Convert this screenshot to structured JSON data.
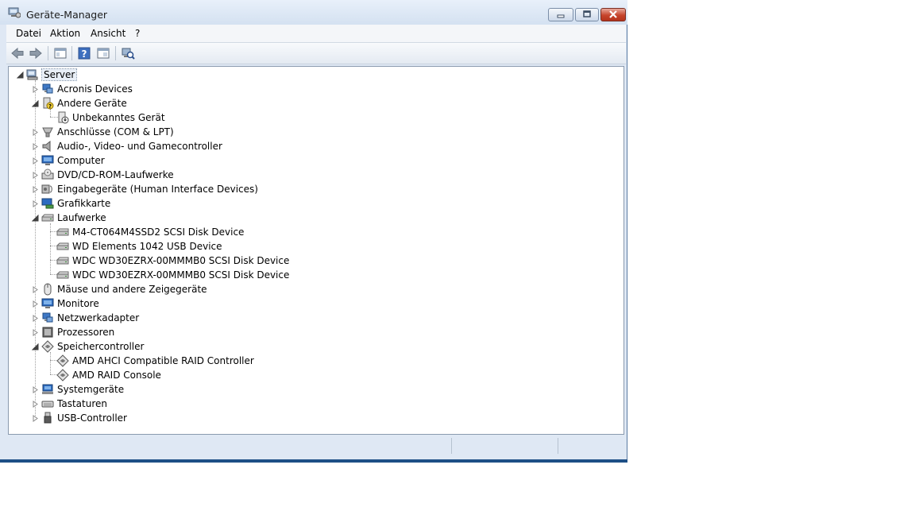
{
  "window": {
    "title": "Geräte-Manager",
    "accent_color": "#dfe8f4",
    "close_color": "#c6442c"
  },
  "menu": [
    {
      "label": "Datei"
    },
    {
      "label": "Aktion"
    },
    {
      "label": "Ansicht"
    },
    {
      "label": "?"
    }
  ],
  "toolbar": [
    {
      "name": "back-arrow-icon"
    },
    {
      "name": "forward-arrow-icon"
    },
    {
      "name": "show-hide-console-tree-icon"
    },
    {
      "name": "help-icon"
    },
    {
      "name": "properties-icon"
    },
    {
      "name": "scan-hardware-icon"
    }
  ],
  "tree": {
    "root": {
      "label": "Server",
      "icon": "computer-icon"
    },
    "groups": [
      {
        "label": "Acronis Devices",
        "icon": "network-icon",
        "expanded": false,
        "children": []
      },
      {
        "label": "Andere Geräte",
        "icon": "unknown-device-icon",
        "expanded": true,
        "children": [
          {
            "label": "Unbekanntes Gerät",
            "icon": "warning-device-icon"
          }
        ]
      },
      {
        "label": "Anschlüsse (COM & LPT)",
        "icon": "port-icon",
        "expanded": false,
        "children": []
      },
      {
        "label": "Audio-, Video- und Gamecontroller",
        "icon": "speaker-icon",
        "expanded": false,
        "children": []
      },
      {
        "label": "Computer",
        "icon": "monitor-icon",
        "expanded": false,
        "children": []
      },
      {
        "label": "DVD/CD-ROM-Laufwerke",
        "icon": "disc-drive-icon",
        "expanded": false,
        "children": []
      },
      {
        "label": "Eingabegeräte (Human Interface Devices)",
        "icon": "hid-icon",
        "expanded": false,
        "children": []
      },
      {
        "label": "Grafikkarte",
        "icon": "display-adapter-icon",
        "expanded": false,
        "children": []
      },
      {
        "label": "Laufwerke",
        "icon": "disk-drive-icon",
        "expanded": true,
        "children": [
          {
            "label": "M4-CT064M4SSD2 SCSI Disk Device",
            "icon": "disk-drive-icon"
          },
          {
            "label": "WD Elements 1042 USB Device",
            "icon": "disk-drive-icon"
          },
          {
            "label": "WDC WD30EZRX-00MMMB0 SCSI Disk Device",
            "icon": "disk-drive-icon"
          },
          {
            "label": "WDC WD30EZRX-00MMMB0 SCSI Disk Device",
            "icon": "disk-drive-icon"
          }
        ]
      },
      {
        "label": "Mäuse und andere Zeigegeräte",
        "icon": "mouse-icon",
        "expanded": false,
        "children": []
      },
      {
        "label": "Monitore",
        "icon": "monitor-icon",
        "expanded": false,
        "children": []
      },
      {
        "label": "Netzwerkadapter",
        "icon": "network-icon",
        "expanded": false,
        "children": []
      },
      {
        "label": "Prozessoren",
        "icon": "processor-icon",
        "expanded": false,
        "children": []
      },
      {
        "label": "Speichercontroller",
        "icon": "storage-controller-icon",
        "expanded": true,
        "children": [
          {
            "label": "AMD AHCI Compatible RAID Controller",
            "icon": "storage-controller-icon"
          },
          {
            "label": "AMD RAID Console",
            "icon": "storage-controller-icon"
          }
        ]
      },
      {
        "label": "Systemgeräte",
        "icon": "system-device-icon",
        "expanded": false,
        "children": []
      },
      {
        "label": "Tastaturen",
        "icon": "keyboard-icon",
        "expanded": false,
        "children": []
      },
      {
        "label": "USB-Controller",
        "icon": "usb-icon",
        "expanded": false,
        "children": []
      }
    ]
  }
}
